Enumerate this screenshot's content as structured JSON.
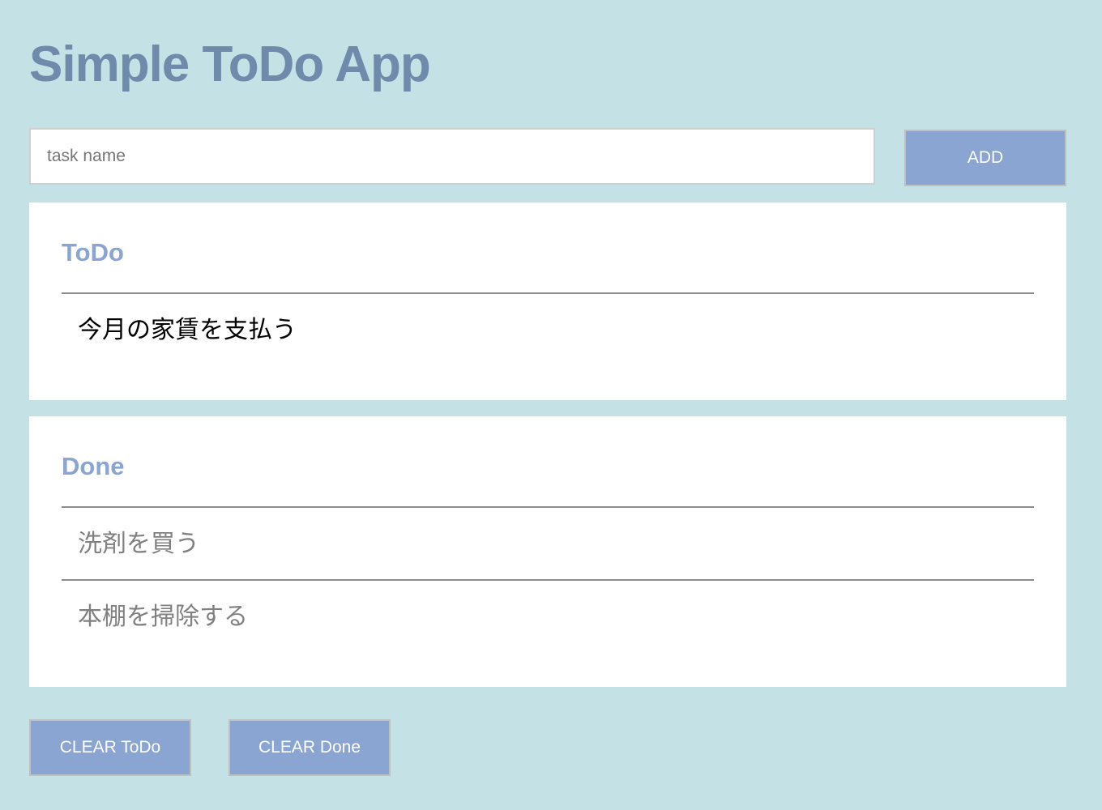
{
  "header": {
    "title": "Simple ToDo App"
  },
  "form": {
    "input_placeholder": "task name",
    "input_value": "",
    "add_label": "ADD"
  },
  "todo": {
    "title": "ToDo",
    "items": [
      "今月の家賃を支払う"
    ]
  },
  "done": {
    "title": "Done",
    "items": [
      "洗剤を買う",
      "本棚を掃除する"
    ]
  },
  "footer": {
    "clear_todo_label": "CLEAR ToDo",
    "clear_done_label": "CLEAR Done"
  },
  "colors": {
    "background": "#c4e1e6",
    "title": "#6f8aab",
    "accent": "#8aa5d2",
    "done_text": "#808080"
  }
}
